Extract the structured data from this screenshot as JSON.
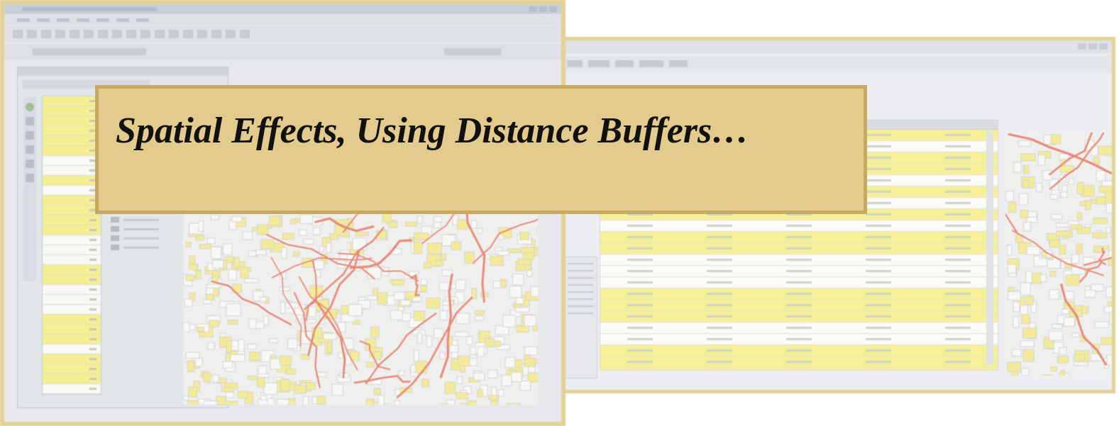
{
  "slide": {
    "title": "Spatial Effects, Using Distance Buffers…"
  },
  "colors": {
    "frame_border": "#e3d196",
    "banner_fill": "#e2cb8c",
    "banner_border": "#c7a95f",
    "highlight_row": "#f6f196",
    "road": "#e88a78",
    "map_fill": "#f3eb9a",
    "parcel": "#cfcfcf"
  },
  "left_screenshot": {
    "icons": [
      "globe-tool-icon",
      "select-tool-icon",
      "pan-tool-icon",
      "zoom-tool-icon",
      "identify-tool-icon",
      "measure-tool-icon"
    ],
    "table_rows": [
      "yellow",
      "yellow",
      "yellow",
      "yellow",
      "yellow",
      "yellow",
      "white",
      "white",
      "yellow",
      "white",
      "yellow",
      "yellow",
      "yellow",
      "yellow",
      "white",
      "white",
      "white",
      "yellow",
      "yellow",
      "white",
      "white",
      "white",
      "yellow",
      "yellow",
      "yellow",
      "white",
      "yellow",
      "yellow",
      "yellow",
      "white",
      "yellow",
      "yellow",
      "white"
    ]
  },
  "right_screenshot": {
    "table_rows": [
      "yellow",
      "white",
      "yellow",
      "yellow",
      "white",
      "yellow",
      "white",
      "yellow",
      "white",
      "yellow",
      "yellow",
      "white",
      "white",
      "white",
      "yellow",
      "yellow",
      "yellow",
      "white",
      "white",
      "yellow",
      "yellow",
      "yellow",
      "white"
    ]
  }
}
